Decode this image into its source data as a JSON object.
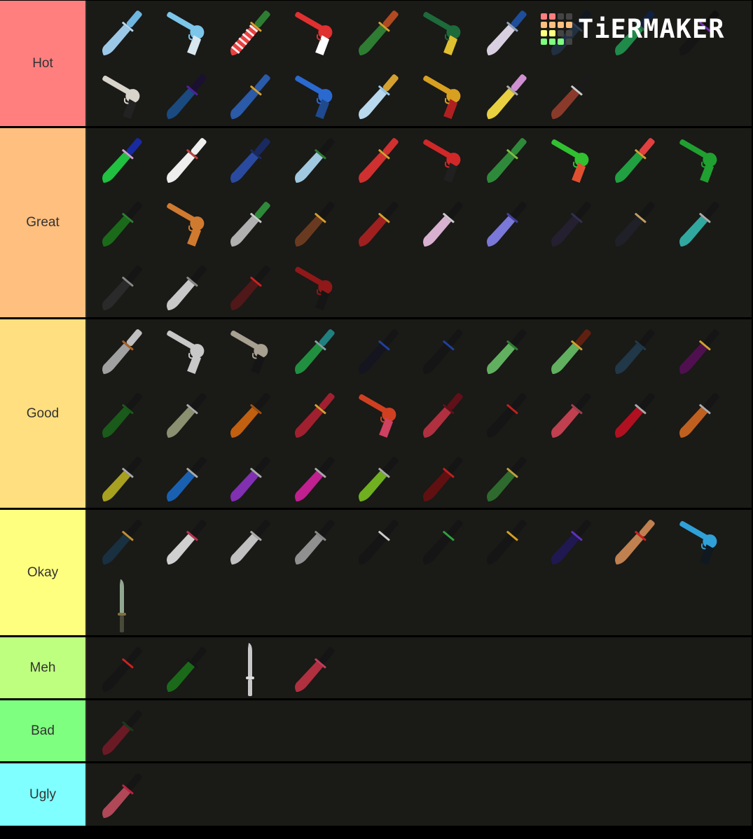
{
  "logo": {
    "text": "TiERMAKER",
    "grid_colors": [
      "#ff7f7f",
      "#ff7f7f",
      "#444444",
      "#444444",
      "#ffbf7f",
      "#ffbf7f",
      "#ffbf7f",
      "#ffbf7f",
      "#ffff7f",
      "#ffff7f",
      "#444444",
      "#444444",
      "#7fff7f",
      "#7fff7f",
      "#7fff7f",
      "#444444"
    ]
  },
  "tiers": [
    {
      "label": "Hot",
      "color": "#ff7f7f",
      "items": [
        {
          "type": "knife",
          "blade": "#9cc8e8",
          "handle": "#6fb6e0",
          "guard": "#b8d8ee"
        },
        {
          "type": "gun",
          "body": "#7cc6ea",
          "grip": "#d8e8f0"
        },
        {
          "type": "knife",
          "blade": "#e84040",
          "handle": "#2e7d32",
          "guard": "#d4a030",
          "stripes": "#ffffff"
        },
        {
          "type": "gun",
          "body": "#e03030",
          "grip": "#ffffff"
        },
        {
          "type": "knife",
          "blade": "#2e7d32",
          "handle": "#b04a20",
          "guard": "#d4a030"
        },
        {
          "type": "gun",
          "body": "#1d6a3a",
          "grip": "#e0c030"
        },
        {
          "type": "knife",
          "blade": "#d8d0e0",
          "handle": "#1e4d9a",
          "guard": "#8aa0c0"
        },
        {
          "type": "knife",
          "blade": "#203040",
          "handle": "#101820",
          "guard": "#304050"
        },
        {
          "type": "knife",
          "blade": "#1f8a4a",
          "handle": "#102040",
          "guard": "#2c6040"
        },
        {
          "type": "knife",
          "blade": "#151515",
          "handle": "#101010",
          "guard": "#7a30b0"
        },
        {
          "type": "gun",
          "body": "#d8d4cc",
          "grip": "#222222"
        },
        {
          "type": "knife",
          "blade": "#1a4a80",
          "handle": "#1a1030",
          "guard": "#5020a0"
        },
        {
          "type": "knife",
          "blade": "#2a5aa8",
          "handle": "#2a5aa8",
          "guard": "#d4a030"
        },
        {
          "type": "gun",
          "body": "#2a6ad0",
          "grip": "#1f4a90"
        },
        {
          "type": "knife",
          "blade": "#b8d8ee",
          "handle": "#d4a030",
          "guard": "#9cc8e8"
        },
        {
          "type": "gun",
          "body": "#d8a020",
          "grip": "#b02020"
        },
        {
          "type": "knife",
          "blade": "#e8d040",
          "handle": "#d090d0",
          "guard": "#aaaaaa"
        },
        {
          "type": "knife",
          "blade": "#8a3a2a",
          "handle": "#1a1a1a",
          "guard": "#cccccc"
        }
      ]
    },
    {
      "label": "Great",
      "color": "#ffbf7f",
      "items": [
        {
          "type": "knife",
          "blade": "#20c040",
          "handle": "#1a2aa0",
          "guard": "#d0a0d0"
        },
        {
          "type": "knife",
          "blade": "#eeeeee",
          "handle": "#eeeeee",
          "guard": "#c04040"
        },
        {
          "type": "knife",
          "blade": "#2a4aa0",
          "handle": "#1a2a60",
          "guard": "#1a2a60"
        },
        {
          "type": "knife",
          "blade": "#a0c8e0",
          "handle": "#151515",
          "guard": "#2e7d32"
        },
        {
          "type": "knife",
          "blade": "#d03030",
          "handle": "#d03030",
          "guard": "#d4a030"
        },
        {
          "type": "gun",
          "body": "#d02828",
          "grip": "#202020"
        },
        {
          "type": "knife",
          "blade": "#2e8a3a",
          "handle": "#2e8a3a",
          "guard": "#80c040"
        },
        {
          "type": "gun",
          "body": "#30c030",
          "grip": "#e05030"
        },
        {
          "type": "knife",
          "blade": "#20a040",
          "handle": "#e04040",
          "guard": "#d4a030"
        },
        {
          "type": "gun",
          "body": "#20a030",
          "grip": "#20a030"
        },
        {
          "type": "knife",
          "blade": "#1a6a1a",
          "handle": "#151515",
          "guard": "#2e7d32"
        },
        {
          "type": "gun",
          "body": "#d07a30",
          "grip": "#d07a30"
        },
        {
          "type": "knife",
          "blade": "#b0b0b0",
          "handle": "#2e8a3a",
          "guard": "#cccccc"
        },
        {
          "type": "knife",
          "blade": "#6a3a20",
          "handle": "#151515",
          "guard": "#d4a030"
        },
        {
          "type": "knife",
          "blade": "#a02020",
          "handle": "#151515",
          "guard": "#d4a030"
        },
        {
          "type": "knife",
          "blade": "#d8b0d0",
          "handle": "#151515",
          "guard": "#cccccc"
        },
        {
          "type": "knife",
          "blade": "#7a78d8",
          "handle": "#151515",
          "guard": "#4040a0"
        },
        {
          "type": "knife",
          "blade": "#252030",
          "handle": "#151515",
          "guard": "#303050"
        },
        {
          "type": "knife",
          "blade": "#202028",
          "handle": "#151515",
          "guard": "#c0a060"
        },
        {
          "type": "knife",
          "blade": "#30a8a0",
          "handle": "#151515",
          "guard": "#aaaaaa"
        },
        {
          "type": "knife",
          "blade": "#2a2a2a",
          "handle": "#151515",
          "guard": "#888888"
        },
        {
          "type": "knife",
          "blade": "#c8c8c8",
          "handle": "#151515",
          "guard": "#888888"
        },
        {
          "type": "knife",
          "blade": "#501818",
          "handle": "#151515",
          "guard": "#d02020"
        },
        {
          "type": "gun",
          "body": "#901818",
          "grip": "#151515"
        }
      ]
    },
    {
      "label": "Good",
      "color": "#ffdf7f",
      "items": [
        {
          "type": "knife",
          "blade": "#a0a0a0",
          "handle": "#c0c0c0",
          "guard": "#b06020"
        },
        {
          "type": "gun",
          "body": "#c8c8c8",
          "grip": "#c8c8c8"
        },
        {
          "type": "gun",
          "body": "#a8a090",
          "grip": "#151515"
        },
        {
          "type": "knife",
          "blade": "#209040",
          "handle": "#208080",
          "guard": "#80a0a0"
        },
        {
          "type": "knife",
          "blade": "#151520",
          "handle": "#151515",
          "guard": "#2040a0"
        },
        {
          "type": "knife",
          "blade": "#151515",
          "handle": "#151515",
          "guard": "#2040a0"
        },
        {
          "type": "knife",
          "blade": "#60b060",
          "handle": "#151515",
          "guard": "#2e7d32"
        },
        {
          "type": "knife",
          "blade": "#60b060",
          "handle": "#602010",
          "guard": "#d4a030"
        },
        {
          "type": "knife",
          "blade": "#203848",
          "handle": "#151515",
          "guard": "#203848"
        },
        {
          "type": "knife",
          "blade": "#501050",
          "handle": "#151515",
          "guard": "#d4a030"
        },
        {
          "type": "knife",
          "blade": "#1a5a1a",
          "handle": "#151515",
          "guard": "#1a5a1a"
        },
        {
          "type": "knife",
          "blade": "#8a9070",
          "handle": "#151515",
          "guard": "#aaaaaa"
        },
        {
          "type": "knife",
          "blade": "#c06010",
          "handle": "#151515",
          "guard": "#a05010"
        },
        {
          "type": "knife",
          "blade": "#a02030",
          "handle": "#a02030",
          "guard": "#d4a030"
        },
        {
          "type": "gun",
          "body": "#d04020",
          "grip": "#d04060"
        },
        {
          "type": "knife",
          "blade": "#b03040",
          "handle": "#601018",
          "guard": "#601018"
        },
        {
          "type": "knife",
          "blade": "#151515",
          "handle": "#151515",
          "guard": "#c02020"
        },
        {
          "type": "knife",
          "blade": "#c04050",
          "handle": "#151515",
          "guard": "#a04050"
        },
        {
          "type": "knife",
          "blade": "#b01020",
          "handle": "#151515",
          "guard": "#aaaaaa"
        },
        {
          "type": "knife",
          "blade": "#c06020",
          "handle": "#151515",
          "guard": "#aaaaaa"
        },
        {
          "type": "knife",
          "blade": "#a8a020",
          "handle": "#151515",
          "guard": "#aaaaaa"
        },
        {
          "type": "knife",
          "blade": "#1a60b0",
          "handle": "#151515",
          "guard": "#aaaaaa"
        },
        {
          "type": "knife",
          "blade": "#8030b0",
          "handle": "#151515",
          "guard": "#aaaaaa"
        },
        {
          "type": "knife",
          "blade": "#c02090",
          "handle": "#151515",
          "guard": "#aaaaaa"
        },
        {
          "type": "knife",
          "blade": "#70b020",
          "handle": "#151515",
          "guard": "#aaaaaa"
        },
        {
          "type": "knife",
          "blade": "#601010",
          "handle": "#151515",
          "guard": "#c02020"
        },
        {
          "type": "knife",
          "blade": "#2e6a2e",
          "handle": "#151515",
          "guard": "#c0a040"
        }
      ]
    },
    {
      "label": "Okay",
      "color": "#ffff7f",
      "items": [
        {
          "type": "knife",
          "blade": "#183040",
          "handle": "#151515",
          "guard": "#c09030"
        },
        {
          "type": "knife",
          "blade": "#d0d0d0",
          "handle": "#151515",
          "guard": "#c03050"
        },
        {
          "type": "knife",
          "blade": "#c0c0c0",
          "handle": "#151515",
          "guard": "#aaaaaa"
        },
        {
          "type": "knife",
          "blade": "#909090",
          "handle": "#151515",
          "guard": "#888888"
        },
        {
          "type": "knife",
          "blade": "#151515",
          "handle": "#151515",
          "guard": "#cccccc"
        },
        {
          "type": "knife",
          "blade": "#151515",
          "handle": "#151515",
          "guard": "#30a040"
        },
        {
          "type": "knife",
          "blade": "#151515",
          "handle": "#151515",
          "guard": "#d4a020"
        },
        {
          "type": "knife",
          "blade": "#201850",
          "handle": "#151515",
          "guard": "#6030c0"
        },
        {
          "type": "knife",
          "blade": "#c08050",
          "handle": "#c08050",
          "guard": "#d02020"
        },
        {
          "type": "gun",
          "body": "#30a0d8",
          "grip": "#101820"
        },
        {
          "type": "knife",
          "blade": "#90a890",
          "handle": "#4a4a3a",
          "guard": "#807040",
          "vertical": true
        }
      ]
    },
    {
      "label": "Meh",
      "color": "#bfff7f",
      "items": [
        {
          "type": "knife",
          "blade": "#151515",
          "handle": "#151515",
          "guard": "#d02020"
        },
        {
          "type": "knife",
          "blade": "#1a6a1a",
          "handle": "#151515",
          "guard": "#151515"
        },
        {
          "type": "knife",
          "blade": "#c8c8c8",
          "handle": "#c8c8c8",
          "guard": "#dddddd",
          "vertical": true
        },
        {
          "type": "knife",
          "blade": "#b03040",
          "handle": "#151515",
          "guard": "#c04060"
        }
      ]
    },
    {
      "label": "Bad",
      "color": "#7fff7f",
      "items": [
        {
          "type": "knife",
          "blade": "#6a1a24",
          "handle": "#151515",
          "guard": "#1a3a1a"
        }
      ]
    },
    {
      "label": "Ugly",
      "color": "#7fffff",
      "items": [
        {
          "type": "knife",
          "blade": "#b04858",
          "handle": "#151515",
          "guard": "#c02040"
        }
      ]
    }
  ]
}
